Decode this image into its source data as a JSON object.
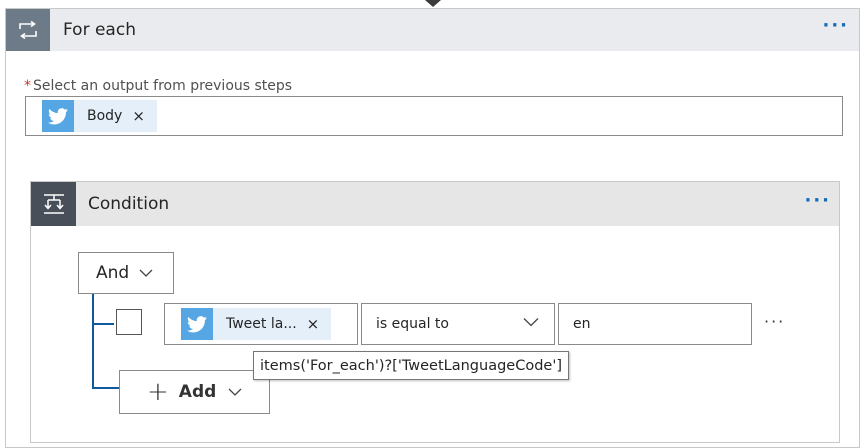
{
  "foreach": {
    "title": "For each",
    "more": "···",
    "output_label": "Select an output from previous steps",
    "required_marker": "*",
    "output_token": {
      "label": "Body",
      "remove": "×",
      "icon": "twitter-icon"
    }
  },
  "condition": {
    "title": "Condition",
    "more": "···",
    "logic_select": {
      "value": "And"
    },
    "row": {
      "left_token": {
        "label": "Tweet la...",
        "remove": "×",
        "icon": "twitter-icon"
      },
      "operator": "is equal to",
      "value": "en",
      "more": "···"
    },
    "add_button": {
      "label": "Add",
      "icon": "plus-icon"
    }
  },
  "tooltip": {
    "text": "items('For_each')?['TweetLanguageCode']"
  },
  "colors": {
    "twitter_blue": "#55a6e2",
    "token_bg": "#e4effa",
    "accent": "#0f6cbd",
    "tree_line": "#0f5a9c",
    "foreach_icon_bg": "#6d7b88",
    "condition_icon_bg": "#484f58"
  }
}
